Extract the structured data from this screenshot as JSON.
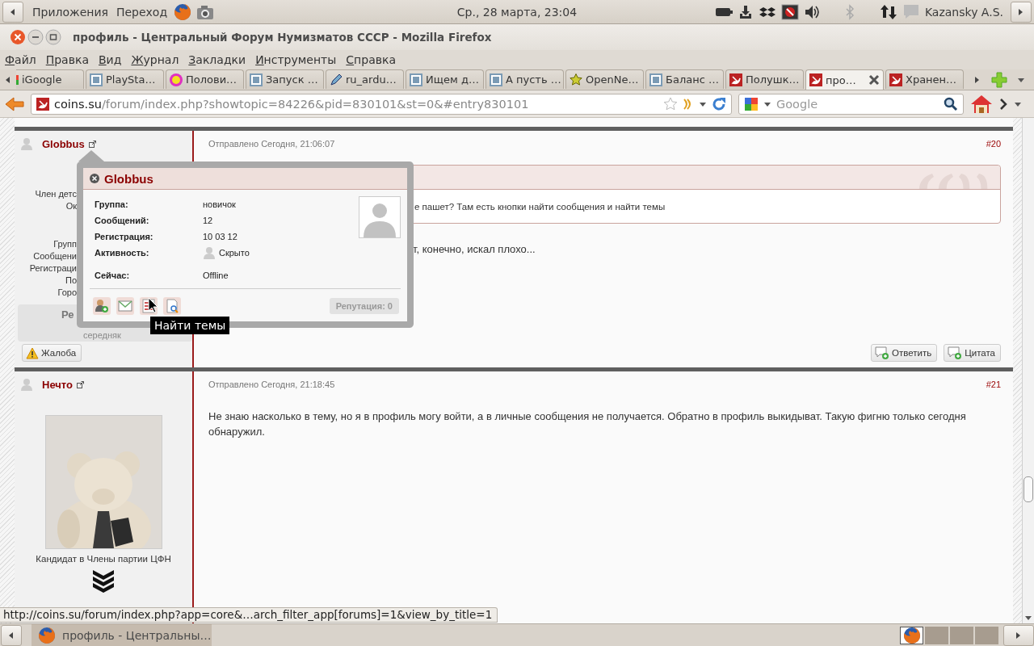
{
  "top_panel": {
    "menus": [
      "Приложения",
      "Переход"
    ],
    "clock": "Ср., 28 марта, 23:04",
    "user": "Kazansky A.S."
  },
  "window": {
    "title": "профиль - Центральный Форум Нумизматов СССР - Mozilla Firefox"
  },
  "menu_bar": [
    "Файл",
    "Правка",
    "Вид",
    "Журнал",
    "Закладки",
    "Инструменты",
    "Справка"
  ],
  "tabs": [
    {
      "label": "iGoogle",
      "kind": "google",
      "selected": false
    },
    {
      "label": "PlaySta…",
      "kind": "letter",
      "selected": false
    },
    {
      "label": "Полови…",
      "kind": "ip",
      "selected": false
    },
    {
      "label": "Запуск …",
      "kind": "letter",
      "selected": false
    },
    {
      "label": "ru_ardu…",
      "kind": "pencil",
      "selected": false
    },
    {
      "label": "Ищем д…",
      "kind": "letter",
      "selected": false
    },
    {
      "label": "А пусть …",
      "kind": "letter",
      "selected": false
    },
    {
      "label": "OpenNe…",
      "kind": "star",
      "selected": false
    },
    {
      "label": "Баланс …",
      "kind": "letter",
      "selected": false
    },
    {
      "label": "Полушк…",
      "kind": "sickle",
      "selected": false
    },
    {
      "label": "про…",
      "kind": "sickle",
      "selected": true
    },
    {
      "label": "Хранен…",
      "kind": "sickle",
      "selected": false
    }
  ],
  "navigation": {
    "url_host": "coins.su",
    "url_path": "/forum/index.php?showtopic=84226&pid=830101&st=0&#entry830101",
    "search_placeholder": "Google"
  },
  "posts": [
    {
      "author": "Globbus",
      "posted": "Отправлено Сегодня, 21:06:07",
      "number": "#20",
      "title_lines": [
        "Член детс",
        "Ок"
      ],
      "fields": [
        "Групп",
        "Сообщени",
        "Регистраци",
        "По",
        "Горо"
      ],
      "reputation": "Ре",
      "rank": "середняк",
      "quote": "е пашет? Там есть кнопки найти сообщения и найти темы",
      "text": "т, конечно, искал плохо...",
      "report": "Жалоба",
      "actions": [
        "Ответить",
        "Цитата"
      ]
    },
    {
      "author": "Нечто",
      "posted": "Отправлено Сегодня, 21:18:45",
      "number": "#21",
      "member_title": "Кандидат в Члены партии ЦФН",
      "text": "Не знаю насколько в тему, но я в профиль могу войти, а в личные сообщения не получается. Обратно в профиль выкидыват. Такую фигню только сегодня обнаружил."
    }
  ],
  "popup": {
    "name": "Globbus",
    "fields": [
      {
        "label": "Группа:",
        "value": "новичок",
        "kind": "plain"
      },
      {
        "label": "Сообщений:",
        "value": "12",
        "kind": "plain"
      },
      {
        "label": "Регистрация:",
        "value": "10 03 12",
        "kind": "plain"
      },
      {
        "label": "Активность:",
        "value": "Скрыто",
        "kind": "presence"
      },
      {
        "label": "Сейчас:",
        "value": "Offline",
        "kind": "plain"
      }
    ],
    "reputation": "Репутация: 0",
    "tooltip": "Найти темы"
  },
  "status_url": "http://coins.su/forum/index.php?app=core&…arch_filter_app[forums]=1&view_by_title=1",
  "taskbar": {
    "items": [
      {
        "label": "профиль - Центральны…",
        "selected": true
      }
    ]
  }
}
